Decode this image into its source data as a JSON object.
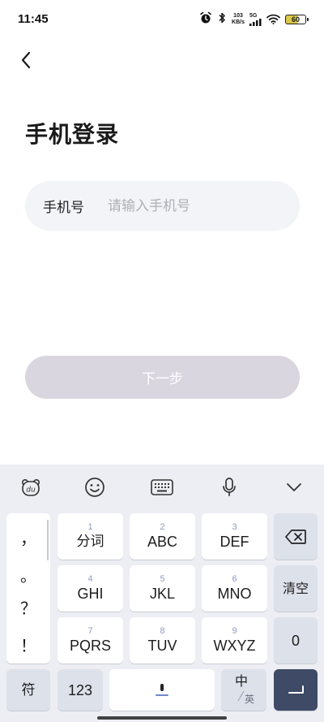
{
  "status_bar": {
    "time": "11:45",
    "net_speed_value": "103",
    "net_speed_unit": "KB/s",
    "signal_type": "5G",
    "battery": "60"
  },
  "header": {
    "title": "手机登录"
  },
  "form": {
    "phone_label": "手机号",
    "phone_placeholder": "请输入手机号",
    "phone_value": ""
  },
  "next_button": {
    "label": "下一步"
  },
  "keyboard": {
    "toolbar": [
      "du-bear-icon",
      "emoji-icon",
      "keyboard-icon",
      "microphone-icon",
      "chevron-down-icon"
    ],
    "punctuation": [
      "，",
      "。",
      "？",
      "！"
    ],
    "keys": [
      {
        "num": "1",
        "label": "分词"
      },
      {
        "num": "2",
        "label": "ABC"
      },
      {
        "num": "3",
        "label": "DEF"
      },
      {
        "num": "4",
        "label": "GHI"
      },
      {
        "num": "5",
        "label": "JKL"
      },
      {
        "num": "6",
        "label": "MNO"
      },
      {
        "num": "7",
        "label": "PQRS"
      },
      {
        "num": "8",
        "label": "TUV"
      },
      {
        "num": "9",
        "label": "WXYZ"
      }
    ],
    "clear_label": "清空",
    "zero_label": "0",
    "symbol_label": "符",
    "num_mode_label": "123",
    "lang_main": "中",
    "lang_alt": "英"
  },
  "colors": {
    "primary_disabled": "#d9d6e0",
    "enter_key": "#3e4a66",
    "input_bg": "#f3f4f7",
    "keyboard_bg": "#eceef3"
  }
}
